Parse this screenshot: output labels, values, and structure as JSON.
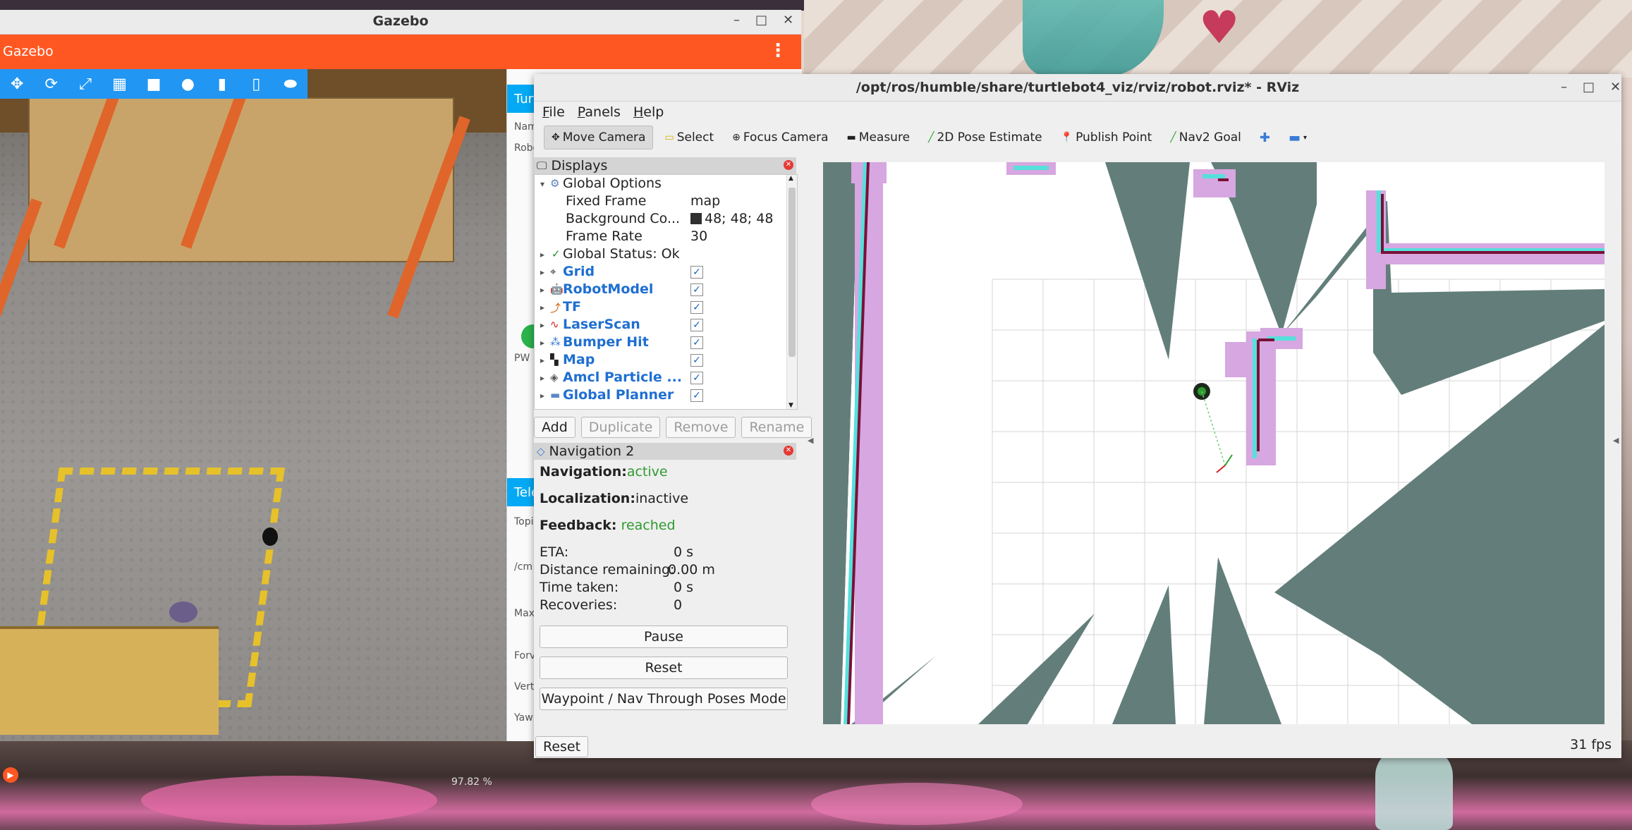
{
  "gazebo": {
    "window_title": "Gazebo",
    "app_title": "Gazebo",
    "fps_text": "97.82 %",
    "side_header": "Turtl",
    "side_header2": "Tele",
    "side_labels": [
      "Nam",
      "Robo",
      "PW",
      "Topi",
      "/cm",
      "Max",
      "Forv",
      "Vert",
      "Yaw"
    ],
    "toolbar_icons": [
      "translate-icon",
      "rotate-icon",
      "scale-icon",
      "grid-icon",
      "box-icon",
      "sphere-icon",
      "cylinder-icon",
      "capsule-icon",
      "ellipsoid-icon"
    ]
  },
  "rviz": {
    "window_title": "/opt/ros/humble/share/turtlebot4_viz/rviz/robot.rviz* - RViz",
    "menu": [
      "File",
      "Panels",
      "Help"
    ],
    "tools": [
      {
        "label": "Move Camera",
        "icon": "move-camera-icon",
        "active": true
      },
      {
        "label": "Select",
        "icon": "select-icon"
      },
      {
        "label": "Focus Camera",
        "icon": "focus-camera-icon"
      },
      {
        "label": "Measure",
        "icon": "measure-icon"
      },
      {
        "label": "2D Pose Estimate",
        "icon": "pose-estimate-icon"
      },
      {
        "label": "Publish Point",
        "icon": "publish-point-icon"
      },
      {
        "label": "Nav2 Goal",
        "icon": "nav2-goal-icon"
      }
    ],
    "displays": {
      "title": "Displays",
      "global_options": "Global Options",
      "fixed_frame_key": "Fixed Frame",
      "fixed_frame_val": "map",
      "bg_key": "Background Co...",
      "bg_val": "48; 48; 48",
      "bg_color": "#303030",
      "rate_key": "Frame Rate",
      "rate_val": "30",
      "global_status": "Global Status: Ok",
      "items": [
        {
          "label": "Grid",
          "icon": "grid-icon",
          "checked": true
        },
        {
          "label": "RobotModel",
          "icon": "robot-model-icon",
          "checked": true
        },
        {
          "label": "TF",
          "icon": "tf-icon",
          "checked": true
        },
        {
          "label": "LaserScan",
          "icon": "laser-scan-icon",
          "checked": true
        },
        {
          "label": "Bumper Hit",
          "icon": "bumper-icon",
          "checked": true
        },
        {
          "label": "Map",
          "icon": "map-icon",
          "checked": true
        },
        {
          "label": "Amcl Particle ...",
          "icon": "amcl-icon",
          "checked": true
        },
        {
          "label": "Global Planner",
          "icon": "folder-icon",
          "checked": true
        }
      ],
      "buttons": {
        "add": "Add",
        "duplicate": "Duplicate",
        "remove": "Remove",
        "rename": "Rename"
      }
    },
    "nav2": {
      "title": "Navigation 2",
      "navigation_label": "Navigation:",
      "navigation_val": "active",
      "localization_label": "Localization:",
      "localization_val": "inactive",
      "feedback_label": "Feedback:",
      "feedback_val": "reached",
      "eta_label": "ETA:",
      "eta_val": "0 s",
      "dist_label": "Distance remaining:",
      "dist_val": "0.00 m",
      "time_label": "Time taken:",
      "time_val": "0 s",
      "rec_label": "Recoveries:",
      "rec_val": "0",
      "pause": "Pause",
      "reset": "Reset",
      "mode": "Waypoint / Nav Through Poses Mode"
    },
    "bottom_reset": "Reset",
    "fps": "31 fps",
    "colors": {
      "free": "#ffffff",
      "unknown": "#637e7a",
      "inflation": "#d6a7e0",
      "cyan": "#55e0dc",
      "wall": "#7a1038"
    }
  }
}
